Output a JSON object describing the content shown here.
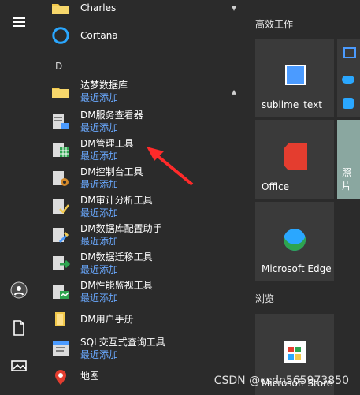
{
  "app_list": [
    {
      "name": "Charles",
      "icon": "folder-icon",
      "expand": "down"
    },
    {
      "name": "Cortana",
      "icon": "cortana-icon"
    },
    {
      "section_letter": "D"
    },
    {
      "name": "达梦数据库",
      "sub": "最近添加",
      "icon": "folder-icon",
      "expand": "up"
    },
    {
      "name": "DM服务查看器",
      "sub": "最近添加",
      "icon": "server-service-icon"
    },
    {
      "name": "DM管理工具",
      "sub": "最近添加",
      "icon": "database-grid-icon"
    },
    {
      "name": "DM控制台工具",
      "sub": "最近添加",
      "icon": "console-gear-icon"
    },
    {
      "name": "DM审计分析工具",
      "sub": "最近添加",
      "icon": "audit-icon"
    },
    {
      "name": "DM数据库配置助手",
      "sub": "最近添加",
      "icon": "config-icon"
    },
    {
      "name": "DM数据迁移工具",
      "sub": "最近添加",
      "icon": "migrate-icon"
    },
    {
      "name": "DM性能监视工具",
      "sub": "最近添加",
      "icon": "monitor-icon"
    },
    {
      "name": "DM用户手册",
      "icon": "book-icon"
    },
    {
      "name": "SQL交互式查询工具",
      "sub": "最近添加",
      "icon": "sql-window-icon"
    },
    {
      "name": "地图",
      "icon": "map-pin-icon"
    }
  ],
  "tiles": {
    "group1_label": "高效工作",
    "group2_label": "浏览",
    "items": [
      {
        "label": "sublime_text",
        "icon": "sublime-icon"
      },
      {
        "label": "Office",
        "icon": "office-icon"
      },
      {
        "label": "Microsoft Edge",
        "icon": "edge-icon"
      },
      {
        "label": "照片",
        "icon": "photos-icon"
      },
      {
        "label": "Microsoft Store",
        "icon": "store-icon"
      }
    ]
  },
  "watermark": "CSDN @csdn565973850",
  "colors": {
    "background": "#2b2b2b",
    "tile": "#3a3a3a",
    "accent_text": "#6aa9ff",
    "arrow": "#ff2a2a"
  }
}
